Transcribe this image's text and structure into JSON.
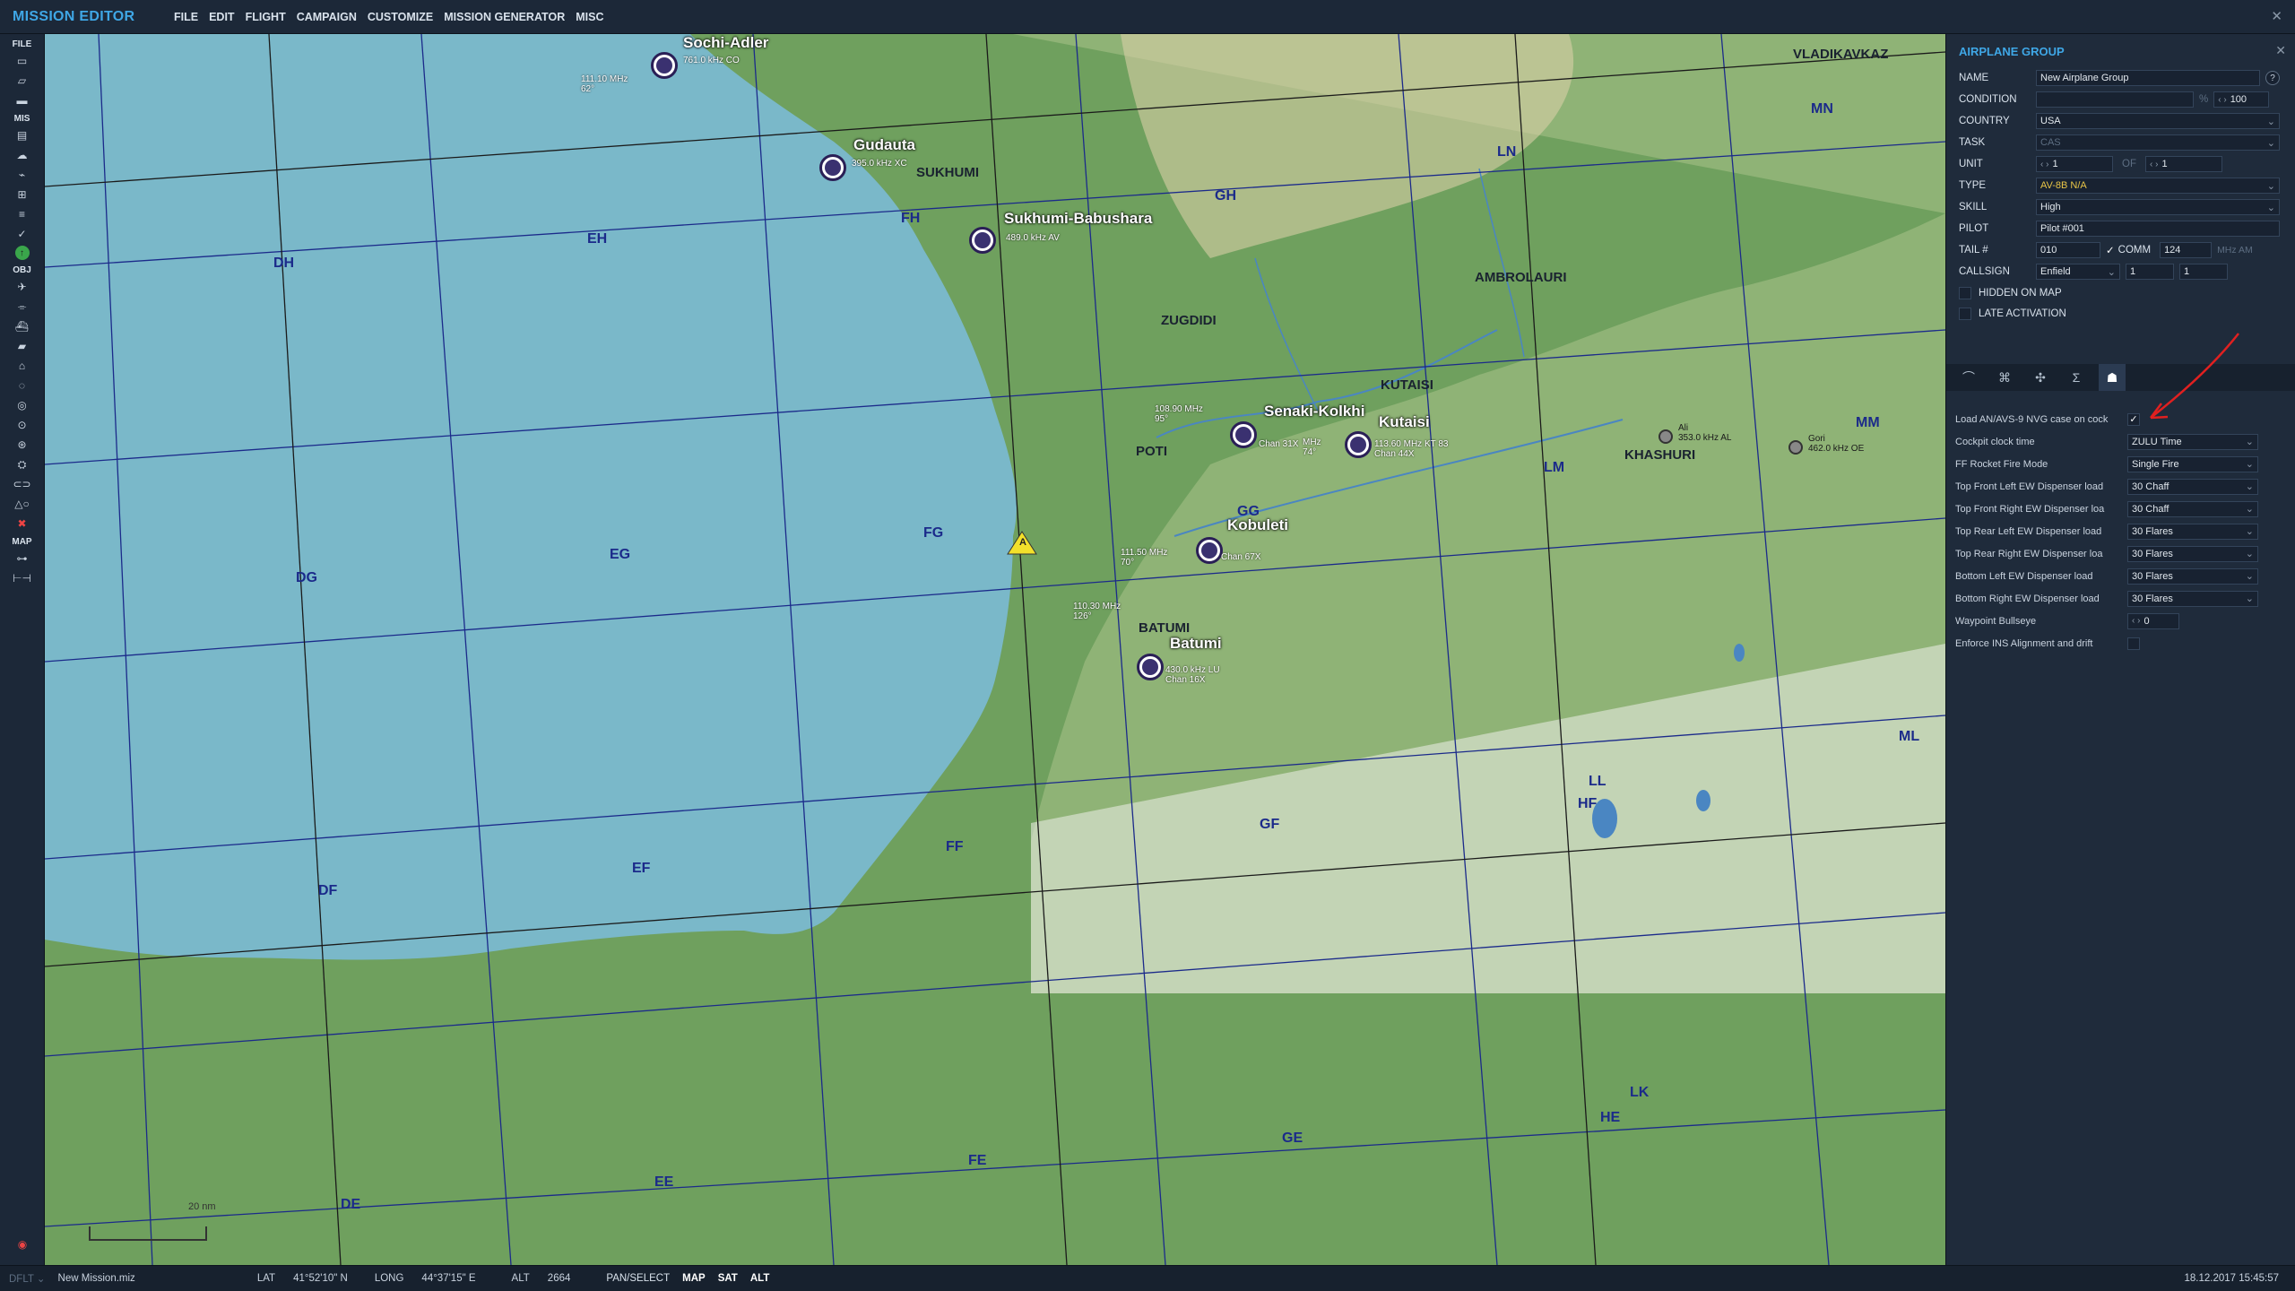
{
  "app": {
    "title": "MISSION EDITOR",
    "menu": [
      "FILE",
      "EDIT",
      "FLIGHT",
      "CAMPAIGN",
      "CUSTOMIZE",
      "MISSION GENERATOR",
      "MISC"
    ]
  },
  "toolbar": {
    "sections": {
      "file": "FILE",
      "mis": "MIS",
      "obj": "OBJ",
      "map": "MAP"
    }
  },
  "map": {
    "grid_labels": [
      "DH",
      "EH",
      "FH",
      "GH",
      "DG",
      "EG",
      "FG",
      "GG",
      "DF",
      "EF",
      "FF",
      "GF",
      "DE",
      "EE",
      "FE",
      "GE",
      "HE",
      "HF",
      "LL",
      "LK",
      "LM",
      "LN",
      "MN",
      "MM",
      "ML"
    ],
    "airfields": [
      {
        "name": "Sochi-Adler",
        "freq": "111.10 MHz\n62°",
        "sub": "761.0 kHz CO"
      },
      {
        "name": "Gudauta",
        "sub": "395.0 kHz XC"
      },
      {
        "name": "Sukhumi-Babushara",
        "sub": "489.0 kHz AV"
      },
      {
        "name": "Senaki-Kolkhi",
        "freq": "108.90 MHz\n95°",
        "sub": "Chan 31X"
      },
      {
        "name": "Kutaisi",
        "freq": "MHz\n74°",
        "sub": "113.60 MHz KT 83\nChan 44X"
      },
      {
        "name": "Kobuleti",
        "freq": "111.50 MHz\n70°",
        "sub": "Chan 67X"
      },
      {
        "name": "Batumi",
        "freq": "110.30 MHz\n126°",
        "sub": "430.0 kHz LU\nChan 16X"
      }
    ],
    "towns": [
      "SUKHUMI",
      "ZUGDIDI",
      "POTI",
      "KUTAISI",
      "AMBROLAURI",
      "KHASHURI",
      "BATUMI",
      "VLADIKAVKAZ"
    ],
    "navaids": [
      {
        "name": "Ali",
        "freq": "353.0 kHz AL"
      },
      {
        "name": "Gori",
        "freq": "462.0 kHz OE"
      }
    ],
    "waypoint_label": "A",
    "scale_label": "20 nm"
  },
  "panel": {
    "title": "AIRPLANE GROUP",
    "name": {
      "label": "NAME",
      "value": "New Airplane Group"
    },
    "condition": {
      "label": "CONDITION",
      "value": "",
      "percent": "%",
      "max": "100"
    },
    "country": {
      "label": "COUNTRY",
      "value": "USA"
    },
    "task": {
      "label": "TASK",
      "value": "CAS"
    },
    "unit": {
      "label": "UNIT",
      "value": "1",
      "of": "OF",
      "total": "1"
    },
    "type": {
      "label": "TYPE",
      "value": "AV-8B N/A"
    },
    "skill": {
      "label": "SKILL",
      "value": "High"
    },
    "pilot": {
      "label": "PILOT",
      "value": "Pilot #001"
    },
    "tail": {
      "label": "TAIL #",
      "value": "010",
      "comm_label": "COMM",
      "comm_value": "124",
      "unit": "MHz AM"
    },
    "callsign": {
      "label": "CALLSIGN",
      "value": "Enfield",
      "n1": "1",
      "n2": "1"
    },
    "hidden_on_map": "HIDDEN ON MAP",
    "late_activation": "LATE ACTIVATION",
    "tabs": [
      "route-icon",
      "payload-icon",
      "aircraft-icon",
      "summary-icon",
      "additional-properties-icon"
    ],
    "aircraft_options": [
      {
        "label": "Load AN/AVS-9 NVG case on cock",
        "type": "checkbox",
        "checked": true
      },
      {
        "label": "Cockpit clock time",
        "value": "ZULU Time"
      },
      {
        "label": "FF Rocket Fire Mode",
        "value": "Single Fire"
      },
      {
        "label": "Top Front Left EW Dispenser load",
        "value": "30 Chaff"
      },
      {
        "label": "Top Front Right EW Dispenser loa",
        "value": "30 Chaff"
      },
      {
        "label": "Top Rear Left EW Dispenser load",
        "value": "30 Flares"
      },
      {
        "label": "Top Rear Right EW Dispenser loa",
        "value": "30 Flares"
      },
      {
        "label": "Bottom Left EW Dispenser load",
        "value": "30 Flares"
      },
      {
        "label": "Bottom Right EW Dispenser load",
        "value": "30 Flares"
      },
      {
        "label": "Waypoint Bullseye",
        "value": "0",
        "type": "spinner"
      },
      {
        "label": "Enforce INS Alignment and drift",
        "type": "checkbox",
        "checked": false
      }
    ]
  },
  "status": {
    "profile": "DFLT",
    "file": "New Mission.miz",
    "lat_label": "LAT",
    "lat": "41°52'10\" N",
    "long_label": "LONG",
    "long": "44°37'15\" E",
    "alt_label": "ALT",
    "alt": "2664",
    "buttons": [
      "PAN/SELECT",
      "MAP",
      "SAT",
      "ALT"
    ],
    "datetime": "18.12.2017 15:45:57"
  },
  "colors": {
    "accent": "#3fa7e6",
    "sea": "#7ab8c9",
    "land_low": "#6fa05e",
    "grid": "#1b2a8a",
    "annotation": "#e02020"
  }
}
